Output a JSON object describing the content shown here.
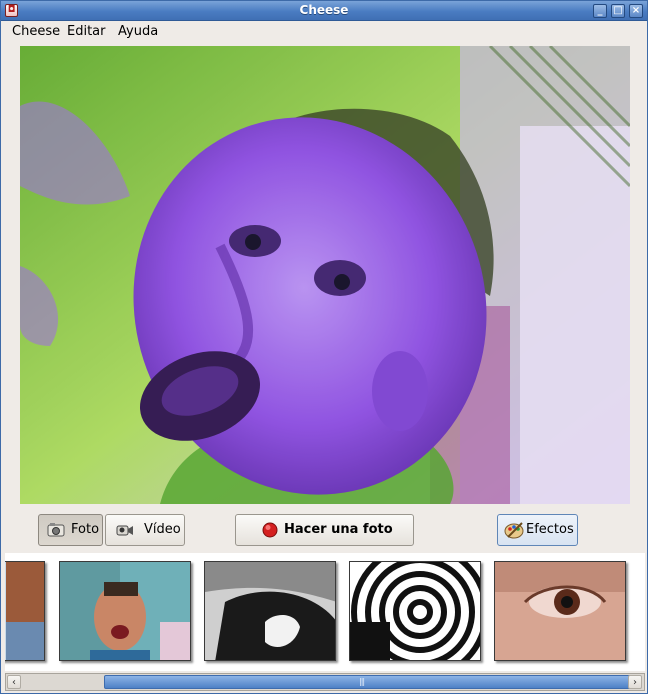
{
  "window": {
    "title": "Cheese",
    "app_icon_glyph": "◘"
  },
  "menu": [
    {
      "label": "Cheese"
    },
    {
      "label": "Editar"
    },
    {
      "label": "Ayuda"
    }
  ],
  "mode_buttons": {
    "photo": {
      "label": "Foto",
      "icon": "camera-icon",
      "selected": true
    },
    "video": {
      "label": "Vídeo",
      "icon": "video-camera-icon",
      "selected": false
    }
  },
  "capture_button": {
    "label": "Hacer una foto",
    "icon": "record-dot-icon",
    "color": "#d42020"
  },
  "effects_button": {
    "label": "Efectos",
    "icon": "palette-icon"
  },
  "thumbnails": [
    {
      "name": "thumbnail-1",
      "style": "color-partial"
    },
    {
      "name": "thumbnail-2",
      "style": "pixelated-color"
    },
    {
      "name": "thumbnail-3",
      "style": "black-white"
    },
    {
      "name": "thumbnail-4",
      "style": "swirl-black-white"
    },
    {
      "name": "thumbnail-5",
      "style": "eye-closeup"
    }
  ],
  "scrollbar": {
    "left_arrow": "‹",
    "right_arrow": "›",
    "grip": "|||"
  },
  "colors": {
    "accent": "#4a7cc2",
    "viewport_green": "#7fb83a",
    "face_purple": "#8a4ae0"
  }
}
